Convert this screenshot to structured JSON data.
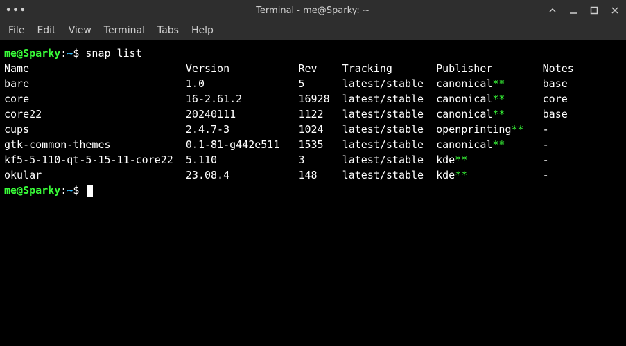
{
  "window": {
    "title": "Terminal - me@Sparky: ~"
  },
  "menu": {
    "file": "File",
    "edit": "Edit",
    "view": "View",
    "terminal": "Terminal",
    "tabs": "Tabs",
    "help": "Help"
  },
  "prompt": {
    "user": "me@Sparky",
    "sep": ":",
    "path": "~",
    "dollar": "$"
  },
  "command": "snap list",
  "headers": {
    "name": "Name",
    "version": "Version",
    "rev": "Rev",
    "tracking": "Tracking",
    "publisher": "Publisher",
    "notes": "Notes"
  },
  "rows": [
    {
      "name": "bare",
      "version": "1.0",
      "rev": "5",
      "tracking": "latest/stable",
      "publisher": "canonical",
      "verified": "**",
      "notes": "base"
    },
    {
      "name": "core",
      "version": "16-2.61.2",
      "rev": "16928",
      "tracking": "latest/stable",
      "publisher": "canonical",
      "verified": "**",
      "notes": "core"
    },
    {
      "name": "core22",
      "version": "20240111",
      "rev": "1122",
      "tracking": "latest/stable",
      "publisher": "canonical",
      "verified": "**",
      "notes": "base"
    },
    {
      "name": "cups",
      "version": "2.4.7-3",
      "rev": "1024",
      "tracking": "latest/stable",
      "publisher": "openprinting",
      "verified": "**",
      "notes": "-"
    },
    {
      "name": "gtk-common-themes",
      "version": "0.1-81-g442e511",
      "rev": "1535",
      "tracking": "latest/stable",
      "publisher": "canonical",
      "verified": "**",
      "notes": "-"
    },
    {
      "name": "kf5-5-110-qt-5-15-11-core22",
      "version": "5.110",
      "rev": "3",
      "tracking": "latest/stable",
      "publisher": "kde",
      "verified": "**",
      "notes": "-"
    },
    {
      "name": "okular",
      "version": "23.08.4",
      "rev": "148",
      "tracking": "latest/stable",
      "publisher": "kde",
      "verified": "**",
      "notes": "-"
    }
  ],
  "columns": {
    "name": 29,
    "version": 18,
    "rev": 7,
    "tracking": 15,
    "publisher": 17
  }
}
